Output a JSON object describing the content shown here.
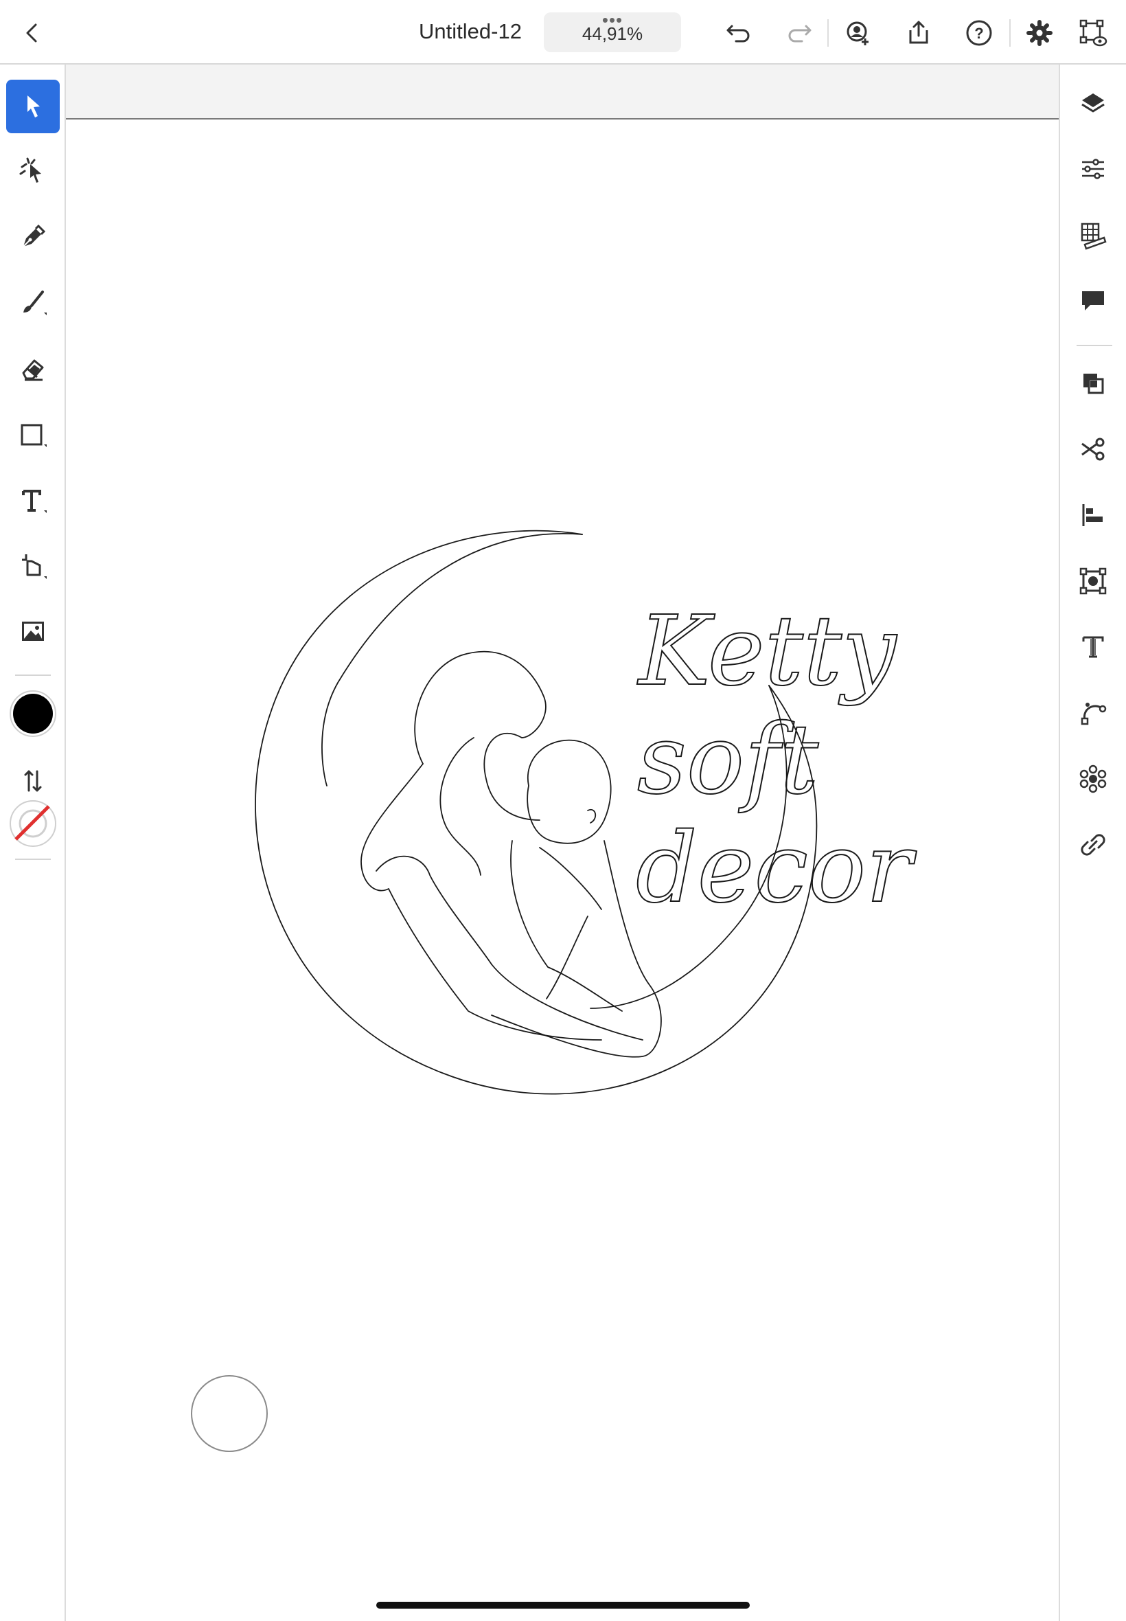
{
  "topbar": {
    "document_title": "Untitled-12",
    "zoom": "44,91%",
    "more_dots": "•••",
    "buttons": {
      "back": "chevron-left-icon",
      "undo": "undo-icon",
      "redo": "redo-icon",
      "invite": "invite-user-icon",
      "share": "share-icon",
      "help": "help-icon",
      "settings": "gear-icon",
      "preview": "preview-icon"
    }
  },
  "left_toolbar": {
    "tools": [
      "selection",
      "direct-selection",
      "pen",
      "paintbrush",
      "eraser",
      "rectangle",
      "type",
      "transform",
      "place-image"
    ],
    "active_tool": "selection",
    "fill_color": "#000000",
    "stroke_color": "none",
    "accent_color": "#2c6fe0"
  },
  "right_panel": {
    "items": [
      "layers",
      "properties",
      "swatches",
      "comments",
      "arrange",
      "cut",
      "align",
      "recolor",
      "text",
      "path",
      "repeat",
      "links"
    ]
  },
  "artwork": {
    "lines": [
      "Ketty",
      "soft",
      "decor"
    ],
    "stroke_color": "#1a1a1a"
  }
}
